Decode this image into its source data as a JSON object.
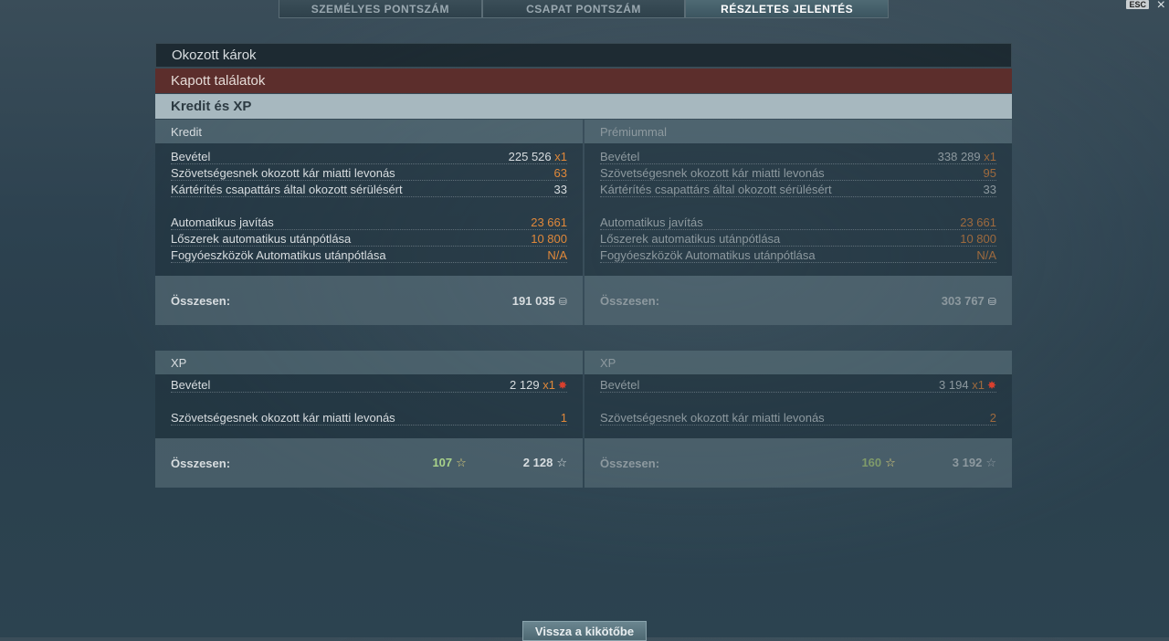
{
  "tabs": [
    {
      "label": "SZEMÉLYES PONTSZÁM"
    },
    {
      "label": "CSAPAT PONTSZÁM"
    },
    {
      "label": "RÉSZLETES JELENTÉS"
    }
  ],
  "esc_label": "ESC",
  "sections": {
    "damage": "Okozott károk",
    "hits": "Kapott találatok",
    "credit_xp": "Kredit és XP"
  },
  "credit": {
    "left_title": "Kredit",
    "right_title": "Prémiummal",
    "rows_left": [
      {
        "label": "Bevétel",
        "value": "225 526",
        "mult": "x1"
      },
      {
        "label": "Szövetségesnek okozott kár miatti levonás",
        "value": "63"
      },
      {
        "label": "Kártérítés csapattárs által okozott sérülésért",
        "value": "33"
      },
      {
        "label": "Automatikus javítás",
        "value": "23 661"
      },
      {
        "label": "Lőszerek automatikus utánpótlása",
        "value": "10 800"
      },
      {
        "label": "Fogyóeszközök Automatikus utánpótlása",
        "value": "N/A"
      }
    ],
    "rows_right": [
      {
        "label": "Bevétel",
        "value": "338 289",
        "mult": "x1"
      },
      {
        "label": "Szövetségesnek okozott kár miatti levonás",
        "value": "95"
      },
      {
        "label": "Kártérítés csapattárs által okozott sérülésért",
        "value": "33"
      },
      {
        "label": "Automatikus javítás",
        "value": "23 661"
      },
      {
        "label": "Lőszerek automatikus utánpótlása",
        "value": "10 800"
      },
      {
        "label": "Fogyóeszközök Automatikus utánpótlása",
        "value": "N/A"
      }
    ],
    "total_label": "Összesen:",
    "total_left": "191 035",
    "total_right": "303 767"
  },
  "xp": {
    "left_title": "XP",
    "right_title": "XP",
    "rows_left": [
      {
        "label": "Bevétel",
        "value": "2 129",
        "mult": "x1"
      },
      {
        "label": "Szövetségesnek okozott kár miatti levonás",
        "value": "1"
      }
    ],
    "rows_right": [
      {
        "label": "Bevétel",
        "value": "3 194",
        "mult": "x1"
      },
      {
        "label": "Szövetségesnek okozott kár miatti levonás",
        "value": "2"
      }
    ],
    "total_label": "Összesen:",
    "left_free": "107",
    "left_xp": "2 128",
    "right_free": "160",
    "right_xp": "3 192"
  },
  "back_button": "Vissza a kikötőbe",
  "colors": {
    "penalty": "#e0883a",
    "free_xp": "#a8d28a",
    "accent_red": "#5c2e2c"
  },
  "icons": {
    "coin": "credit-coin-icon",
    "star": "xp-star-icon",
    "badge": "xp-multiplier-badge-icon"
  }
}
